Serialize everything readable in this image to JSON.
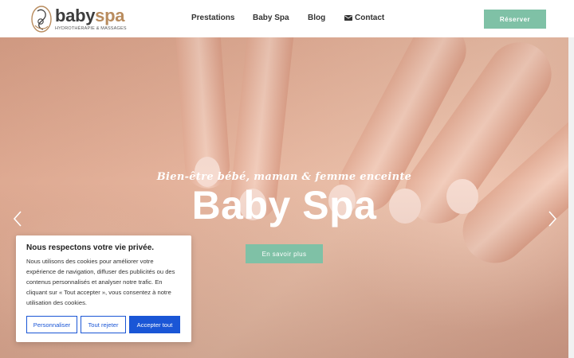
{
  "header": {
    "logo": {
      "word_part1": "baby",
      "word_part2": "spa",
      "tagline": "HYDROTHÉRAPIE & MASSAGES"
    },
    "nav": {
      "prestations": "Prestations",
      "baby_spa": "Baby Spa",
      "blog": "Blog",
      "contact": "Contact"
    },
    "reserve_label": "Réserver"
  },
  "hero": {
    "subtitle": "Bien-être bébé, maman & femme enceinte",
    "title": "Baby Spa",
    "cta_label": "En savoir plus",
    "prev_icon": "chevron-left-icon",
    "next_icon": "chevron-right-icon"
  },
  "cookie": {
    "title": "Nous respectons votre vie privée.",
    "text": "Nous utilisons des cookies pour améliorer votre expérience de navigation, diffuser des publicités ou des contenus personnalisés et analyser notre trafic. En cliquant sur « Tout accepter », vous consentez à notre utilisation des cookies.",
    "customize_label": "Personnaliser",
    "reject_label": "Tout rejeter",
    "accept_label": "Accepter tout"
  },
  "colors": {
    "accent": "#7fc1a6",
    "brand_gold": "#b98c5e",
    "cookie_blue": "#1a56d6"
  }
}
